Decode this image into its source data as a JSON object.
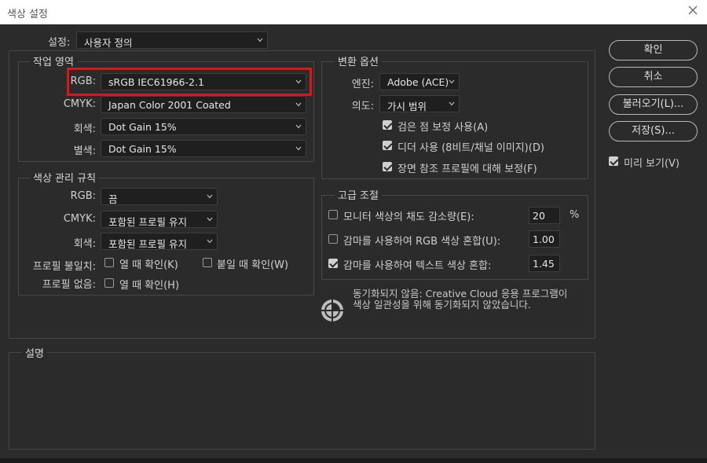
{
  "window": {
    "title": "색상 설정"
  },
  "settings": {
    "label": "설정:",
    "value": "사용자 정의"
  },
  "working_spaces": {
    "title": "작업 영역",
    "rgb": {
      "label": "RGB:",
      "value": "sRGB IEC61966-2.1"
    },
    "cmyk": {
      "label": "CMYK:",
      "value": "Japan Color 2001 Coated"
    },
    "gray": {
      "label": "회색:",
      "value": "Dot Gain 15%"
    },
    "spot": {
      "label": "별색:",
      "value": "Dot Gain 15%"
    }
  },
  "policies": {
    "title": "색상 관리 규칙",
    "rgb": {
      "label": "RGB:",
      "value": "끔"
    },
    "cmyk": {
      "label": "CMYK:",
      "value": "포함된 프로필 유지"
    },
    "gray": {
      "label": "회색:",
      "value": "포함된 프로필 유지"
    },
    "mismatch": {
      "label": "프로필 불일치:",
      "ask_open": "열 때 확인(K)",
      "ask_paste": "붙일 때 확인(W)"
    },
    "missing": {
      "label": "프로필 없음:",
      "ask_open": "열 때 확인(H)"
    }
  },
  "conversion": {
    "title": "변환 옵션",
    "engine": {
      "label": "엔진:",
      "value": "Adobe (ACE)"
    },
    "intent": {
      "label": "의도:",
      "value": "가시 범위"
    },
    "black_point": "검은 점 보정 사용(A)",
    "dither": "디더 사용 (8비트/채널 이미지)(D)",
    "scene_comp": "장면 참조 프로필에 대해 보정(F)"
  },
  "advanced": {
    "title": "고급 조절",
    "desaturate": {
      "label": "모니터 색상의 채도 감소량(E):",
      "value": "20",
      "unit": "%"
    },
    "blend_rgb": {
      "label": "감마를 사용하여 RGB 색상 혼합(U):",
      "value": "1.00"
    },
    "blend_text": {
      "label": "감마를 사용하여 텍스트 색상 혼합:",
      "value": "1.45"
    }
  },
  "sync": {
    "line1": "동기화되지 않음: Creative Cloud 응용 프로그램이",
    "line2": "색상 일관성을 위해 동기화되지 않았습니다."
  },
  "description": {
    "title": "설명"
  },
  "buttons": {
    "ok": "확인",
    "cancel": "취소",
    "load": "불러오기(L)...",
    "save": "저장(S)...",
    "preview": "미리 보기(V)"
  },
  "colors": {
    "highlight": "#e3121b",
    "background": "#2b2b2b"
  }
}
